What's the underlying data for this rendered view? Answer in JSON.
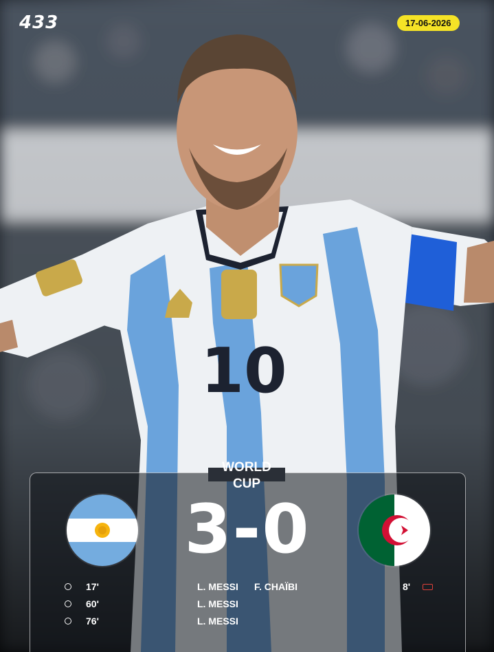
{
  "brand": {
    "logo": "433"
  },
  "date": "17-06-2026",
  "competition": {
    "line1": "WORLD",
    "line2": "CUP"
  },
  "match": {
    "home": {
      "flag_icon": "argentina-flag-icon",
      "score": "3"
    },
    "away": {
      "flag_icon": "algeria-flag-icon",
      "score": "0"
    },
    "separator": "-"
  },
  "home_goals": [
    {
      "minute": "17'",
      "scorer": "L. MESSI"
    },
    {
      "minute": "60'",
      "scorer": "L. MESSI"
    },
    {
      "minute": "76'",
      "scorer": "L. MESSI"
    }
  ],
  "away_events": [
    {
      "player": "F. CHAÏBI",
      "minute": "8'",
      "icon": "red-card-icon"
    }
  ],
  "colors": {
    "accent_yellow": "#f5e326",
    "argentina_blue": "#74acdf",
    "algeria_green": "#006233",
    "algeria_red": "#d21034"
  }
}
